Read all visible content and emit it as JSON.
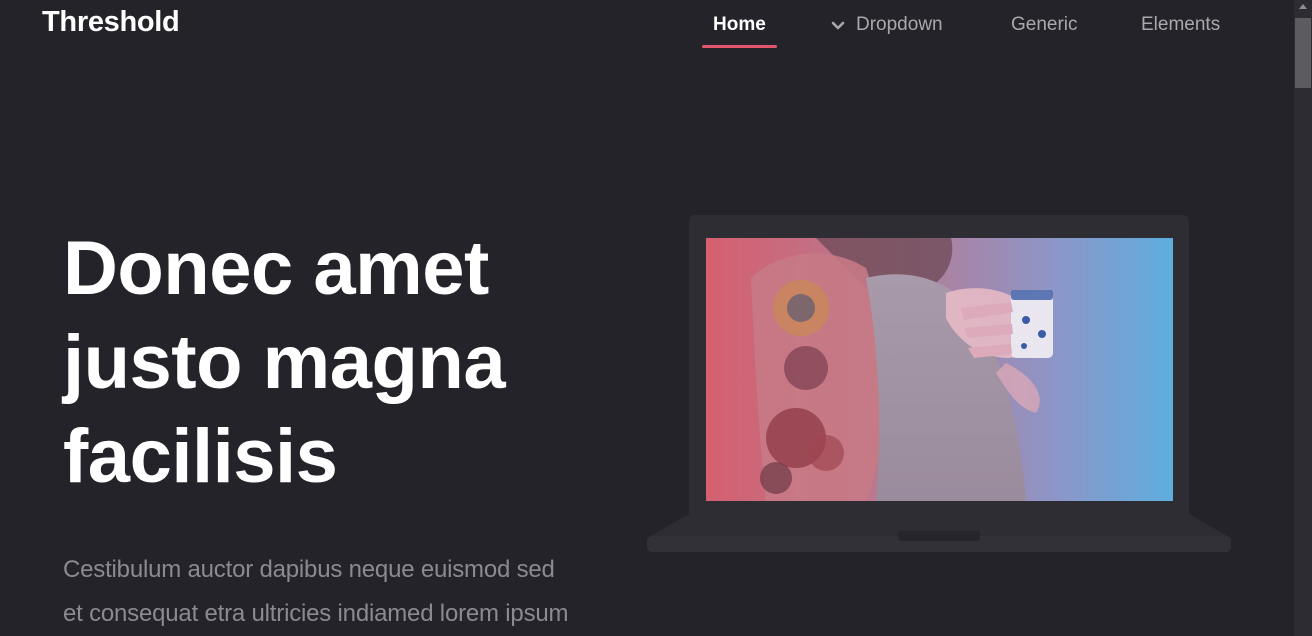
{
  "header": {
    "logo": "Threshold",
    "nav": [
      {
        "label": "Home",
        "active": true
      },
      {
        "label": "Dropdown",
        "active": false,
        "icon": "chevron-down-icon"
      },
      {
        "label": "Generic",
        "active": false
      },
      {
        "label": "Elements",
        "active": false
      }
    ]
  },
  "hero": {
    "title_lines": [
      "Donec amet",
      "justo magna",
      "facilisis"
    ],
    "text_lines": [
      "Cestibulum auctor dapibus neque euismod sed",
      "et consequat etra ultricies indiamed lorem ipsum"
    ]
  },
  "colors": {
    "background": "#242329",
    "accent": "#e1566d",
    "nav_text": "#a9a8ad",
    "body_text": "#8b8a90",
    "laptop": "#2e2d34"
  }
}
